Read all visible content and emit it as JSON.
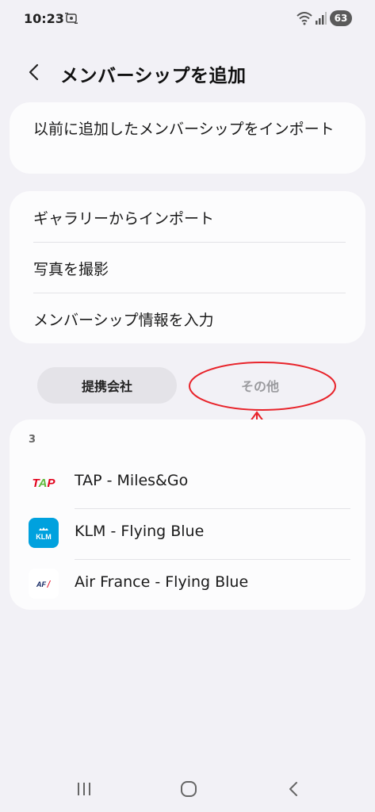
{
  "status": {
    "time": "10:23",
    "battery": "63",
    "icons": [
      "screen-cast-icon",
      "wifi-icon",
      "signal-icon"
    ]
  },
  "header": {
    "title": "メンバーシップを追加",
    "back_icon": "chevron-left-icon"
  },
  "import_previous": {
    "label": "以前に追加したメンバーシップをインポート"
  },
  "options": [
    {
      "label": "ギャラリーからインポート"
    },
    {
      "label": "写真を撮影"
    },
    {
      "label": "メンバーシップ情報を入力"
    }
  ],
  "tabs": {
    "partners": "提携会社",
    "other": "その他"
  },
  "list": {
    "count": "3",
    "items": [
      {
        "label": "TAP - Miles&Go",
        "logo": "tap-logo",
        "logo_text": "TAP"
      },
      {
        "label": "KLM - Flying Blue",
        "logo": "klm-logo",
        "logo_text": "KLM"
      },
      {
        "label": "Air France - Flying Blue",
        "logo": "air-france-logo",
        "logo_text": "AF"
      }
    ]
  },
  "colors": {
    "background": "#f2f1f6",
    "card": "#fcfcfd",
    "annotation_red": "#e8232a",
    "klm_blue": "#00a1de",
    "tap_green": "#5fb83b",
    "tap_red": "#e2001a"
  },
  "navigation": {
    "icons": [
      "recents-icon",
      "home-icon",
      "back-icon"
    ]
  }
}
